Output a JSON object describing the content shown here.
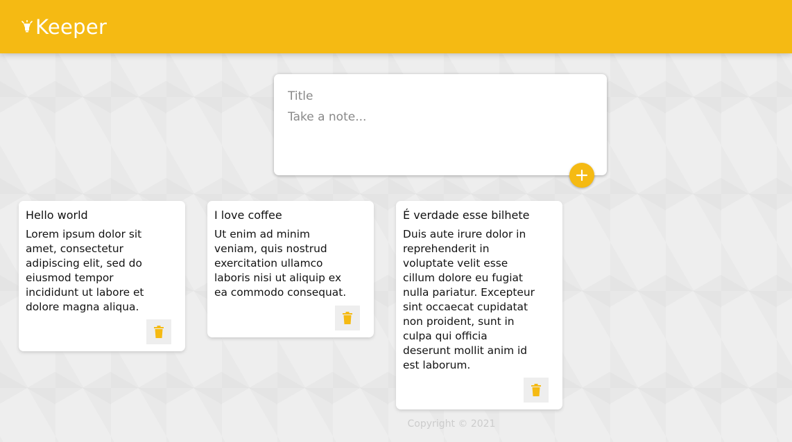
{
  "header": {
    "brand": "Keeper",
    "brand_icon": "lightbulb-icon"
  },
  "create_note": {
    "title_placeholder": "Title",
    "content_placeholder": "Take a note...",
    "add_icon": "plus-icon"
  },
  "notes": [
    {
      "title": "Hello world",
      "content": "Lorem ipsum dolor sit\namet, consectetur\nadipiscing elit, sed do\neiusmod tempor\nincididunt ut labore et\ndolore magna aliqua.",
      "delete_icon": "trash-icon"
    },
    {
      "title": "I love coffee",
      "content": "Ut enim ad minim\nveniam, quis nostrud\nexercitation ullamco\nlaboris nisi ut aliquip ex\nea commodo consequat.",
      "delete_icon": "trash-icon"
    },
    {
      "title": "É verdade esse bilhete",
      "content": "Duis aute irure dolor in\nreprehenderit in\nvoluptate velit esse\ncillum dolore eu fugiat\nnulla pariatur. Excepteur\nsint occaecat cupidatat\nnon proident, sunt in\nculpa qui officia\ndeserunt mollit anim id\nest laborum.",
      "delete_icon": "trash-icon"
    }
  ],
  "footer": {
    "copyright": "Copyright © 2021"
  },
  "colors": {
    "accent": "#f5ba13",
    "background": "#eeeeee"
  }
}
